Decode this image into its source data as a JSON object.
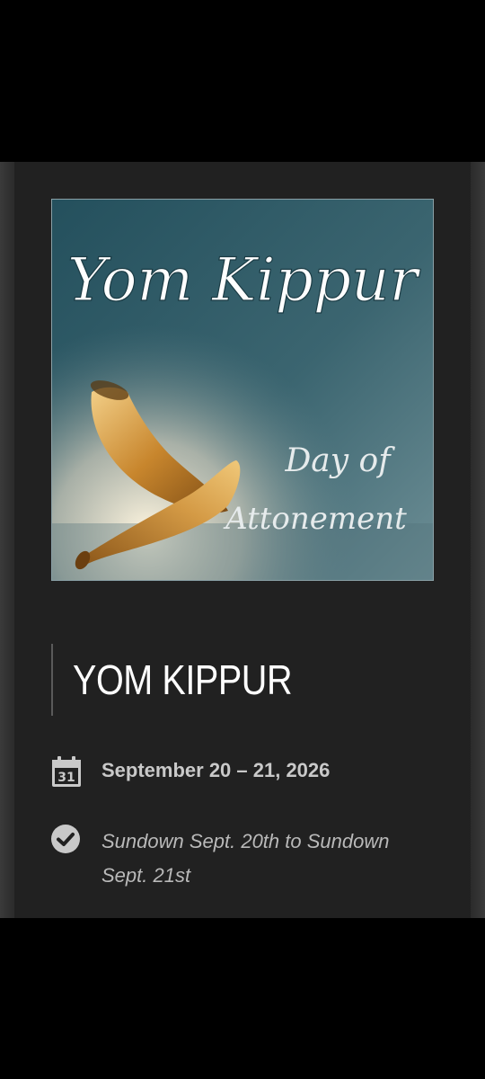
{
  "hero": {
    "title_script": "Yom Kippur",
    "subtitle_line1": "Day of",
    "subtitle_line2": "Attonement",
    "colors": {
      "sky": "#2f5965",
      "horn": "#c98f3a"
    }
  },
  "event": {
    "title": "YOM KIPPUR",
    "date": "September 20 – 21, 2026",
    "calendar_day": "31",
    "time_note": "Sundown Sept. 20th to Sundown Sept. 21st"
  },
  "icons": {
    "date": "calendar-icon",
    "time": "check-circle-icon"
  }
}
